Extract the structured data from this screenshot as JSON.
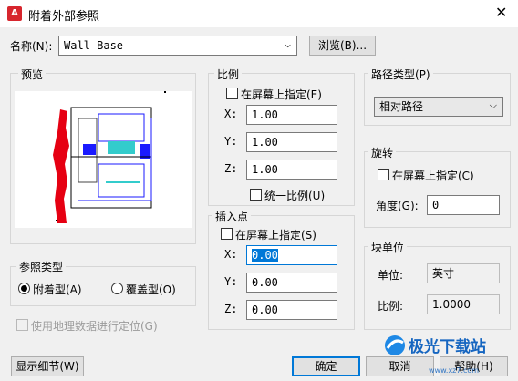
{
  "window": {
    "app_icon": "autocad-logo-icon",
    "app_icon_text": "A",
    "title": "附着外部参照",
    "close_glyph": "✕"
  },
  "name": {
    "label": "名称(N):",
    "value": "Wall Base",
    "browse_label": "浏览(B)..."
  },
  "preview": {
    "label": "预览"
  },
  "reference_type": {
    "label": "参照类型",
    "attach_label": "附着型(A)",
    "overlay_label": "覆盖型(O)",
    "selected": "attach"
  },
  "geo_label": "使用地理数据进行定位(G)",
  "scale": {
    "label": "比例",
    "specify_on_screen": "在屏幕上指定(E)",
    "x_label": "X:",
    "x": "1.00",
    "y_label": "Y:",
    "y": "1.00",
    "z_label": "Z:",
    "z": "1.00",
    "uniform_label": "统一比例(U)"
  },
  "insertion": {
    "label": "插入点",
    "specify_on_screen": "在屏幕上指定(S)",
    "x_label": "X:",
    "x": "0.00",
    "y_label": "Y:",
    "y": "0.00",
    "z_label": "Z:",
    "z": "0.00"
  },
  "path_type": {
    "label": "路径类型(P)",
    "value": "相对路径"
  },
  "rotation": {
    "label": "旋转",
    "specify_on_screen": "在屏幕上指定(C)",
    "angle_label": "角度(G):",
    "angle": "0"
  },
  "block_unit": {
    "label": "块单位",
    "unit_label": "单位:",
    "unit": "英寸",
    "factor_label": "比例:",
    "factor": "1.0000"
  },
  "buttons": {
    "details": "显示细节(W)",
    "ok": "确定",
    "cancel": "取消",
    "help": "帮助(H)"
  },
  "watermark": {
    "text": "极光下载站",
    "url": "www.xz7.com",
    "logo": "aurora-logo-icon"
  },
  "colors": {
    "accent": "#0078d7",
    "preview_red": "#e60012"
  }
}
